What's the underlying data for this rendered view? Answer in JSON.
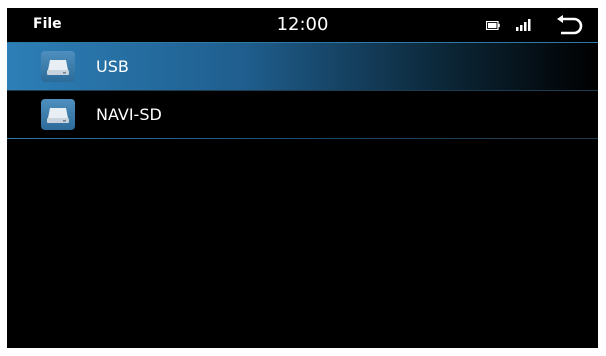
{
  "statusbar": {
    "app_title": "File",
    "time": "12:00",
    "battery_icon": "battery-icon",
    "signal_icon": "signal-icon",
    "back_icon": "back-arrow-icon"
  },
  "drives": [
    {
      "label": "USB",
      "icon": "drive-icon",
      "selected": true
    },
    {
      "label": "NAVI-SD",
      "icon": "drive-icon",
      "selected": false
    }
  ],
  "colors": {
    "background": "#000000",
    "accent": "#2d7fb7",
    "text": "#ffffff"
  }
}
